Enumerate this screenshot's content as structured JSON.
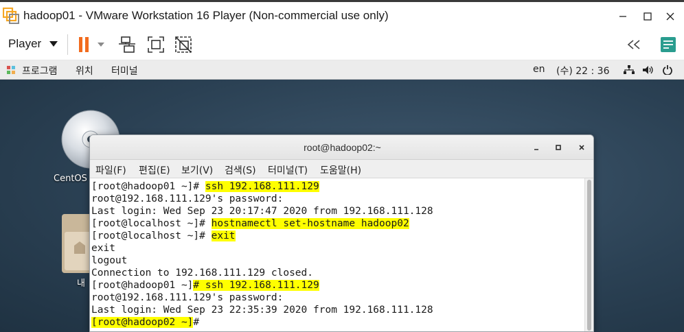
{
  "window": {
    "title": "hadoop01 - VMware Workstation 16 Player (Non-commercial use only)",
    "minimize_icon": "minimize-icon",
    "maximize_icon": "maximize-icon",
    "close_icon": "close-icon"
  },
  "toolbar": {
    "player_label": "Player",
    "accent": "#f26b1d",
    "icons": [
      "pause-icon",
      "network-devices-icon",
      "fullscreen-icon",
      "unity-icon",
      "back-icon",
      "notes-icon"
    ]
  },
  "gnome_panel": {
    "apps_menu": "프로그램",
    "places_menu": "위치",
    "terminal_menu": "터미널",
    "lang": "en",
    "clock": "(수) 22 : 36"
  },
  "desktop": {
    "items": [
      {
        "label": "CentOS"
      },
      {
        "label": "내"
      }
    ]
  },
  "terminal": {
    "title": "root@hadoop02:~",
    "menu": [
      "파일(F)",
      "편집(E)",
      "보기(V)",
      "검색(S)",
      "터미널(T)",
      "도움말(H)"
    ],
    "highlight_color": "#ffff00",
    "lines": [
      {
        "prompt": "[root@hadoop01 ~]# ",
        "cmd": "ssh 192.168.111.129"
      },
      {
        "text": "root@192.168.111.129's password:"
      },
      {
        "text": "Last login: Wed Sep 23 20:17:47 2020 from 192.168.111.128"
      },
      {
        "prompt": "[root@localhost ~]# ",
        "cmd": "hostnamectl set-hostname hadoop02"
      },
      {
        "prompt": "[root@localhost ~]# ",
        "cmd": "exit"
      },
      {
        "text": "exit"
      },
      {
        "text": "logout"
      },
      {
        "text": "Connection to 192.168.111.129 closed."
      },
      {
        "prompt": "[root@hadoop01 ~]",
        "cmd": "# ssh 192.168.111.129"
      },
      {
        "text": "root@192.168.111.129's password:"
      },
      {
        "text": "Last login: Wed Sep 23 22:35:39 2020 from 192.168.111.128"
      },
      {
        "prompt_hl": "[root@hadoop02 ~]",
        "tail": "# "
      }
    ]
  }
}
